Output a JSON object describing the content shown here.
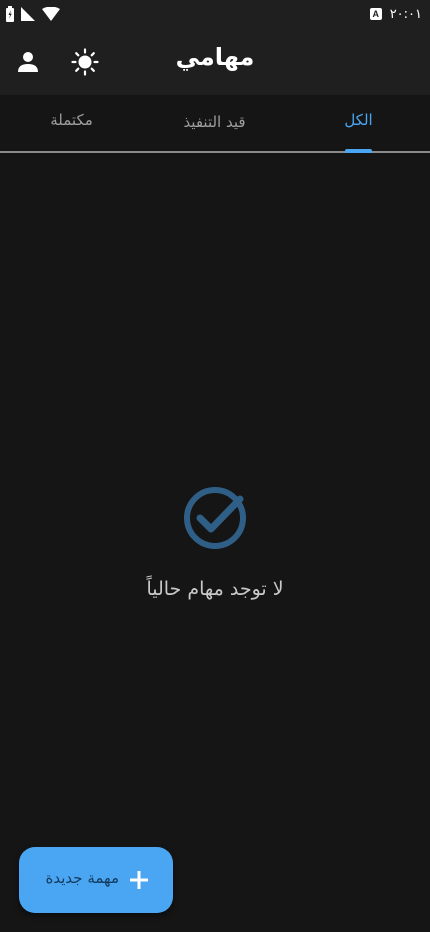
{
  "status_bar": {
    "time": "٢٠:٠١",
    "badge": "A",
    "icons": [
      "battery-charging-icon",
      "signal-icon",
      "wifi-icon"
    ]
  },
  "app_bar": {
    "title": "مهامي",
    "icons": [
      "profile-icon",
      "theme-toggle-icon"
    ]
  },
  "tabs": {
    "items": [
      {
        "label": "الكل",
        "active": true
      },
      {
        "label": "قيد التنفيذ",
        "active": false
      },
      {
        "label": "مكتملة",
        "active": false
      }
    ]
  },
  "empty_state": {
    "icon": "check-circle-icon",
    "message": "لا توجد مهام حالياً"
  },
  "fab": {
    "label": "مهمة جديدة",
    "icon": "plus-icon"
  },
  "colors": {
    "background": "#151515",
    "app_bar": "#1f1f1f",
    "accent": "#4aa6f2",
    "empty_icon": "#2f5f86",
    "muted_text": "#9e9e9e"
  }
}
